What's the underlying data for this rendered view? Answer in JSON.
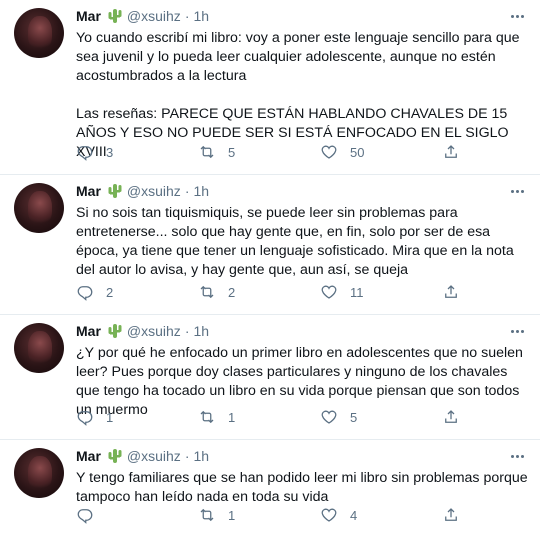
{
  "tweets": [
    {
      "name": "Mar",
      "handle": "@xsuihz",
      "dot": "·",
      "time": "1h",
      "text": "Yo cuando escribí mi libro: voy a poner este lenguaje sencillo para que sea juvenil y lo pueda leer cualquier adolescente, aunque no estén acostumbrados a la lectura\n\nLas reseñas: PARECE QUE ESTÁN HABLANDO CHAVALES DE 15 AÑOS Y ESO NO PUEDE SER SI ESTÁ ENFOCADO EN EL SIGLO XVIII",
      "replies": "3",
      "retweets": "5",
      "likes": "50"
    },
    {
      "name": "Mar",
      "handle": "@xsuihz",
      "dot": "·",
      "time": "1h",
      "text": "Si no sois tan tiquismiquis, se puede leer sin problemas para entretenerse... solo que hay gente que, en fin, solo por ser de esa época, ya tiene que tener un lenguaje sofisticado. Mira que en la nota del autor lo avisa, y hay gente que, aun así, se queja",
      "replies": "2",
      "retweets": "2",
      "likes": "11"
    },
    {
      "name": "Mar",
      "handle": "@xsuihz",
      "dot": "·",
      "time": "1h",
      "text": "¿Y por qué he enfocado un primer libro en adolescentes que no suelen leer? Pues porque doy clases particulares y ninguno de los chavales que tengo ha tocado un libro en su vida porque piensan que son todos un muermo",
      "replies": "1",
      "retweets": "1",
      "likes": "5"
    },
    {
      "name": "Mar",
      "handle": "@xsuihz",
      "dot": "·",
      "time": "1h",
      "text": "Y tengo familiares que se han podido leer mi libro sin problemas porque tampoco han leído nada en toda su vida",
      "replies": "",
      "retweets": "1",
      "likes": "4"
    }
  ],
  "icons": {
    "cactus": "cactus-emoji",
    "reply": "reply-icon",
    "retweet": "retweet-icon",
    "like": "heart-icon",
    "share": "share-icon",
    "more": "more-icon"
  },
  "colors": {
    "text": "#0f1419",
    "secondary": "#5b7083",
    "divider": "#e6ecf0",
    "cactus": "#77b255"
  }
}
